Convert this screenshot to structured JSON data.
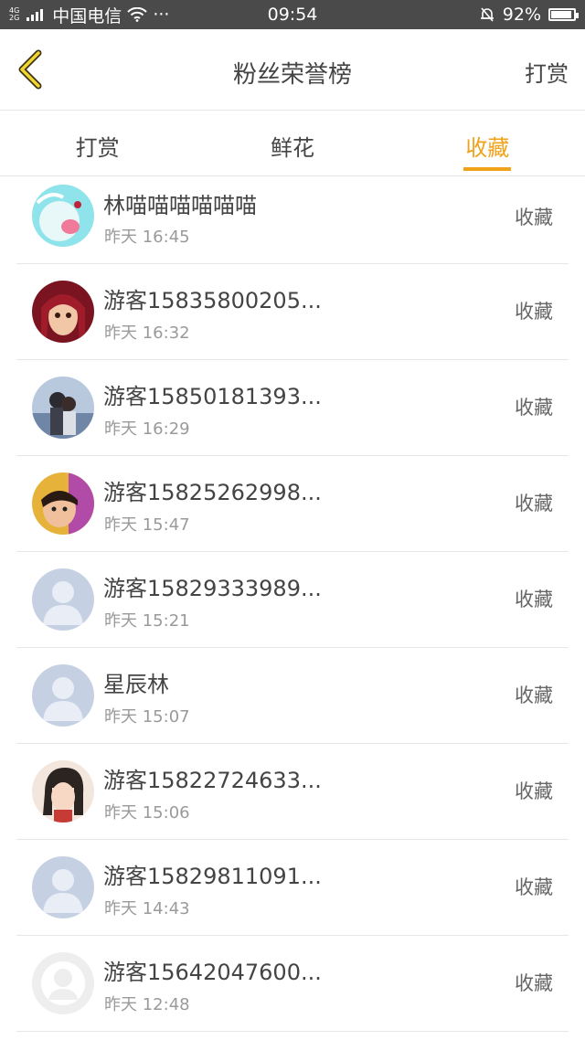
{
  "status": {
    "network_top": "4G",
    "network_bottom": "2G",
    "carrier": "中国电信",
    "dots": "···",
    "time": "09:54",
    "battery_pct": "92%",
    "battery_level": 0.92
  },
  "nav": {
    "title": "粉丝荣誉榜",
    "action": "打赏"
  },
  "tabs": [
    {
      "label": "打赏",
      "active": false
    },
    {
      "label": "鲜花",
      "active": false
    },
    {
      "label": "收藏",
      "active": true
    }
  ],
  "rows": [
    {
      "name": "林喵喵喵喵喵喵",
      "time": "昨天 16:45",
      "badge": "收藏",
      "avatar": "cartoon-blue"
    },
    {
      "name": "游客15835800205...",
      "time": "昨天 16:32",
      "badge": "收藏",
      "avatar": "anime-red"
    },
    {
      "name": "游客15850181393...",
      "time": "昨天 16:29",
      "badge": "收藏",
      "avatar": "photo-couple"
    },
    {
      "name": "游客15825262998...",
      "time": "昨天 15:47",
      "badge": "收藏",
      "avatar": "photo-girl"
    },
    {
      "name": "游客15829333989...",
      "time": "昨天 15:21",
      "badge": "收藏",
      "avatar": "default-blue"
    },
    {
      "name": "星辰林",
      "time": "昨天 15:07",
      "badge": "收藏",
      "avatar": "default-blue"
    },
    {
      "name": "游客15822724633...",
      "time": "昨天 15:06",
      "badge": "收藏",
      "avatar": "anime-girl"
    },
    {
      "name": "游客15829811091...",
      "time": "昨天 14:43",
      "badge": "收藏",
      "avatar": "default-blue"
    },
    {
      "name": "游客15642047600...",
      "time": "昨天 12:48",
      "badge": "收藏",
      "avatar": "default-gray"
    }
  ],
  "colors": {
    "accent": "#f0a21a",
    "statusbar": "#4a4a4a"
  }
}
